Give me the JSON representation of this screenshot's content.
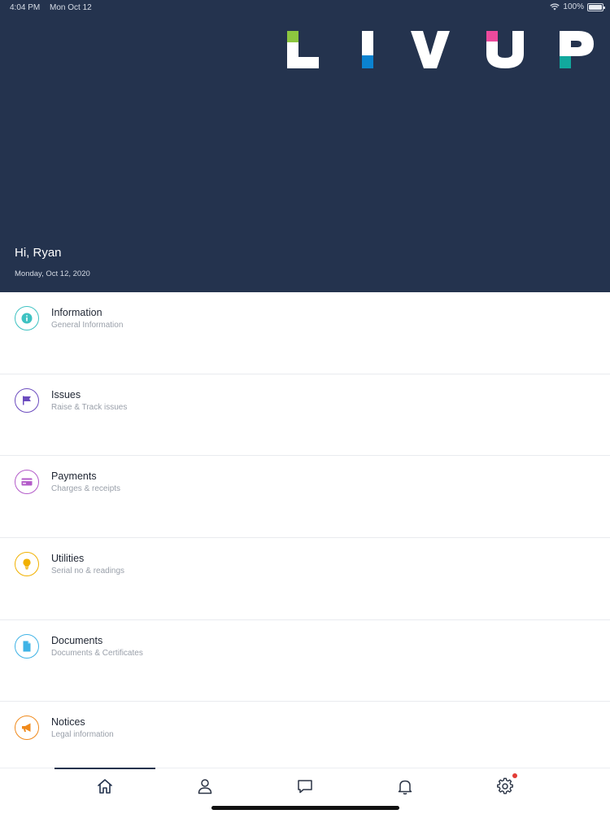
{
  "status_bar": {
    "time": "4:04 PM",
    "date": "Mon Oct 12",
    "battery": "100%"
  },
  "brand": {
    "name": "LIVUP",
    "colors": {
      "accent_green": "#8cc63f",
      "accent_blue": "#0b83d1",
      "accent_pink": "#ec4a9c",
      "accent_teal": "#12a89d"
    }
  },
  "header": {
    "greeting": "Hi, Ryan",
    "date": "Monday, Oct 12, 2020",
    "background": "#24334e"
  },
  "menu": {
    "items": [
      {
        "title": "Information",
        "subtitle": "General Information",
        "icon": "info-icon",
        "color": "#3ec2c2"
      },
      {
        "title": "Issues",
        "subtitle": "Raise & Track issues",
        "icon": "flag-icon",
        "color": "#6c4cbf"
      },
      {
        "title": "Payments",
        "subtitle": "Charges & receipts",
        "icon": "credit-card-icon",
        "color": "#b35bc9"
      },
      {
        "title": "Utilities",
        "subtitle": "Serial no & readings",
        "icon": "lightbulb-icon",
        "color": "#f1b100"
      },
      {
        "title": "Documents",
        "subtitle": "Documents & Certificates",
        "icon": "document-icon",
        "color": "#3fb3e6"
      },
      {
        "title": "Notices",
        "subtitle": "Legal information",
        "icon": "megaphone-icon",
        "color": "#f08a1c"
      }
    ]
  },
  "tabbar": {
    "tabs": [
      {
        "name": "home",
        "icon": "home-icon",
        "active": true
      },
      {
        "name": "profile",
        "icon": "user-icon"
      },
      {
        "name": "messages",
        "icon": "chat-icon"
      },
      {
        "name": "notifications",
        "icon": "bell-icon"
      },
      {
        "name": "settings",
        "icon": "gear-icon",
        "has_badge": true
      }
    ]
  }
}
